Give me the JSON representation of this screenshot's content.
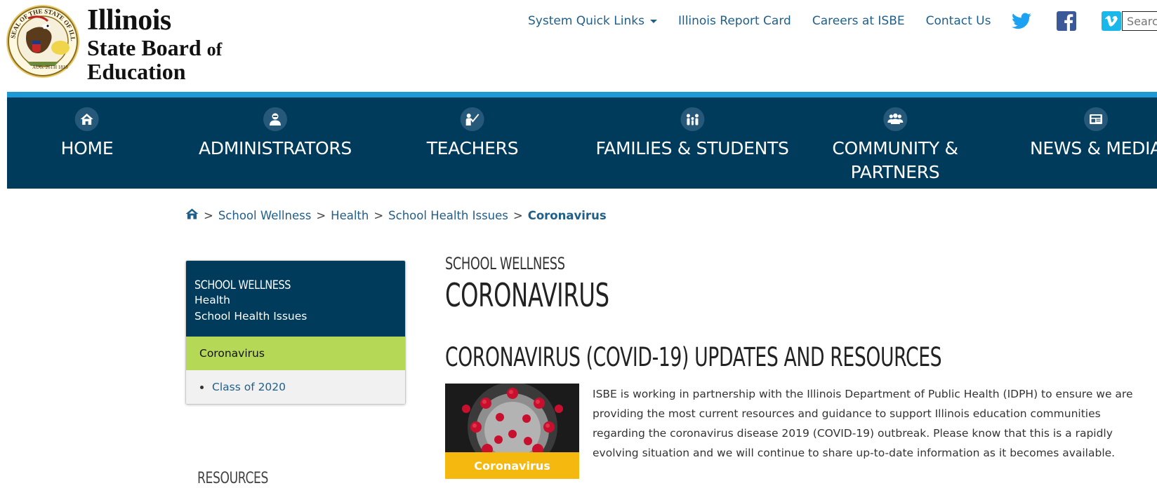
{
  "header": {
    "logo": {
      "line1": "Illinois",
      "line2": "State Board",
      "line2_small": "of",
      "line3": "Education",
      "seal_text": "SEAL OF THE STATE OF ILLINOIS · AUG. 26TH 1818"
    },
    "toplinks": {
      "quick_links": "System Quick Links",
      "report_card": "Illinois Report Card",
      "careers": "Careers at ISBE",
      "contact": "Contact Us"
    },
    "social": [
      "twitter-icon",
      "facebook-icon",
      "vimeo-icon"
    ],
    "search_placeholder": "Search"
  },
  "nav": {
    "items": [
      {
        "label": "HOME",
        "icon": "home-icon"
      },
      {
        "label": "ADMINISTRATORS",
        "icon": "administrator-icon"
      },
      {
        "label": "TEACHERS",
        "icon": "teacher-icon"
      },
      {
        "label": "FAMILIES & STUDENTS",
        "icon": "family-icon"
      },
      {
        "label_line1": "COMMUNITY &",
        "label_line2": "PARTNERS",
        "icon": "community-icon"
      },
      {
        "label": "NEWS & MEDIA",
        "icon": "newspaper-icon"
      }
    ]
  },
  "breadcrumb": {
    "items": [
      "School Wellness",
      "Health",
      "School Health Issues"
    ],
    "current": "Coronavirus",
    "separator": ">"
  },
  "sidebar": {
    "title": "SCHOOL WELLNESS",
    "sub1": "Health",
    "sub2": "School Health Issues",
    "active": "Coronavirus",
    "links": [
      "Class of 2020"
    ],
    "resources_label": "RESOURCES"
  },
  "main": {
    "eyebrow": "SCHOOL WELLNESS",
    "title": "CORONAVIRUS",
    "section_title": "CORONAVIRUS (COVID-19) UPDATES AND RESOURCES",
    "thumbnail_caption": "Coronavirus",
    "body": "ISBE is working in partnership with the Illinois Department of Public Health (IDPH) to ensure we are providing the most current resources and guidance to support Illinois education communities regarding the coronavirus disease 2019 (COVID-19) outbreak. Please know that this is a rapidly evolving situation and we will continue to share up-to-date information as it becomes available."
  },
  "colors": {
    "nav_bg": "#003b5c",
    "nav_stripe": "#1c9ad6",
    "link": "#1f5f8b",
    "active_green": "#b5d957",
    "caption_yellow": "#f4b80f"
  }
}
